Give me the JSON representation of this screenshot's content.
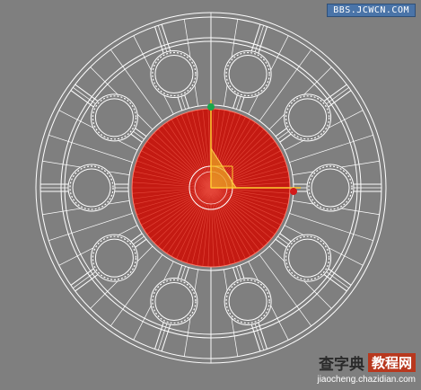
{
  "watermark_top": "BBS.JCWCN.COM",
  "watermark_bottom": {
    "title_main": "查字典",
    "title_box": "教程网",
    "url": "jiaocheng.chazidian.com"
  },
  "colors": {
    "background": "#7f7f7f",
    "wireframe": "#ffffff",
    "selected_disc": "#c41a12",
    "gizmo": "#e8a020",
    "gizmo_y_handle": "#1aa64a",
    "gizmo_x_handle": "#d21a1a"
  }
}
